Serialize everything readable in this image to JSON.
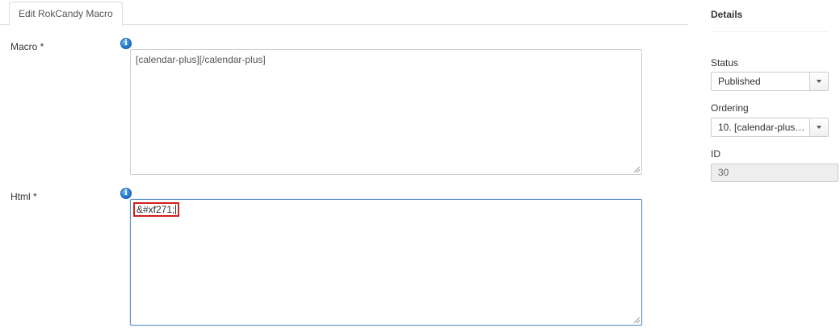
{
  "tabs": [
    {
      "label": "Edit RokCandy Macro",
      "active": true
    }
  ],
  "form": {
    "macro": {
      "label": "Macro *",
      "value": "[calendar-plus][/calendar-plus]",
      "info_icon": "info-icon"
    },
    "html": {
      "label": "Html *",
      "value": "&#xf271;",
      "info_icon": "info-icon"
    }
  },
  "details": {
    "title": "Details",
    "status": {
      "label": "Status",
      "value": "Published"
    },
    "ordering": {
      "label": "Ordering",
      "value": "10. [calendar-plus][/calendar-plus]"
    },
    "id": {
      "label": "ID",
      "value": "30"
    }
  },
  "colors": {
    "highlight_border": "#d22020",
    "focus_border": "#5a8fc7",
    "info_icon": "#2a7fd4"
  }
}
